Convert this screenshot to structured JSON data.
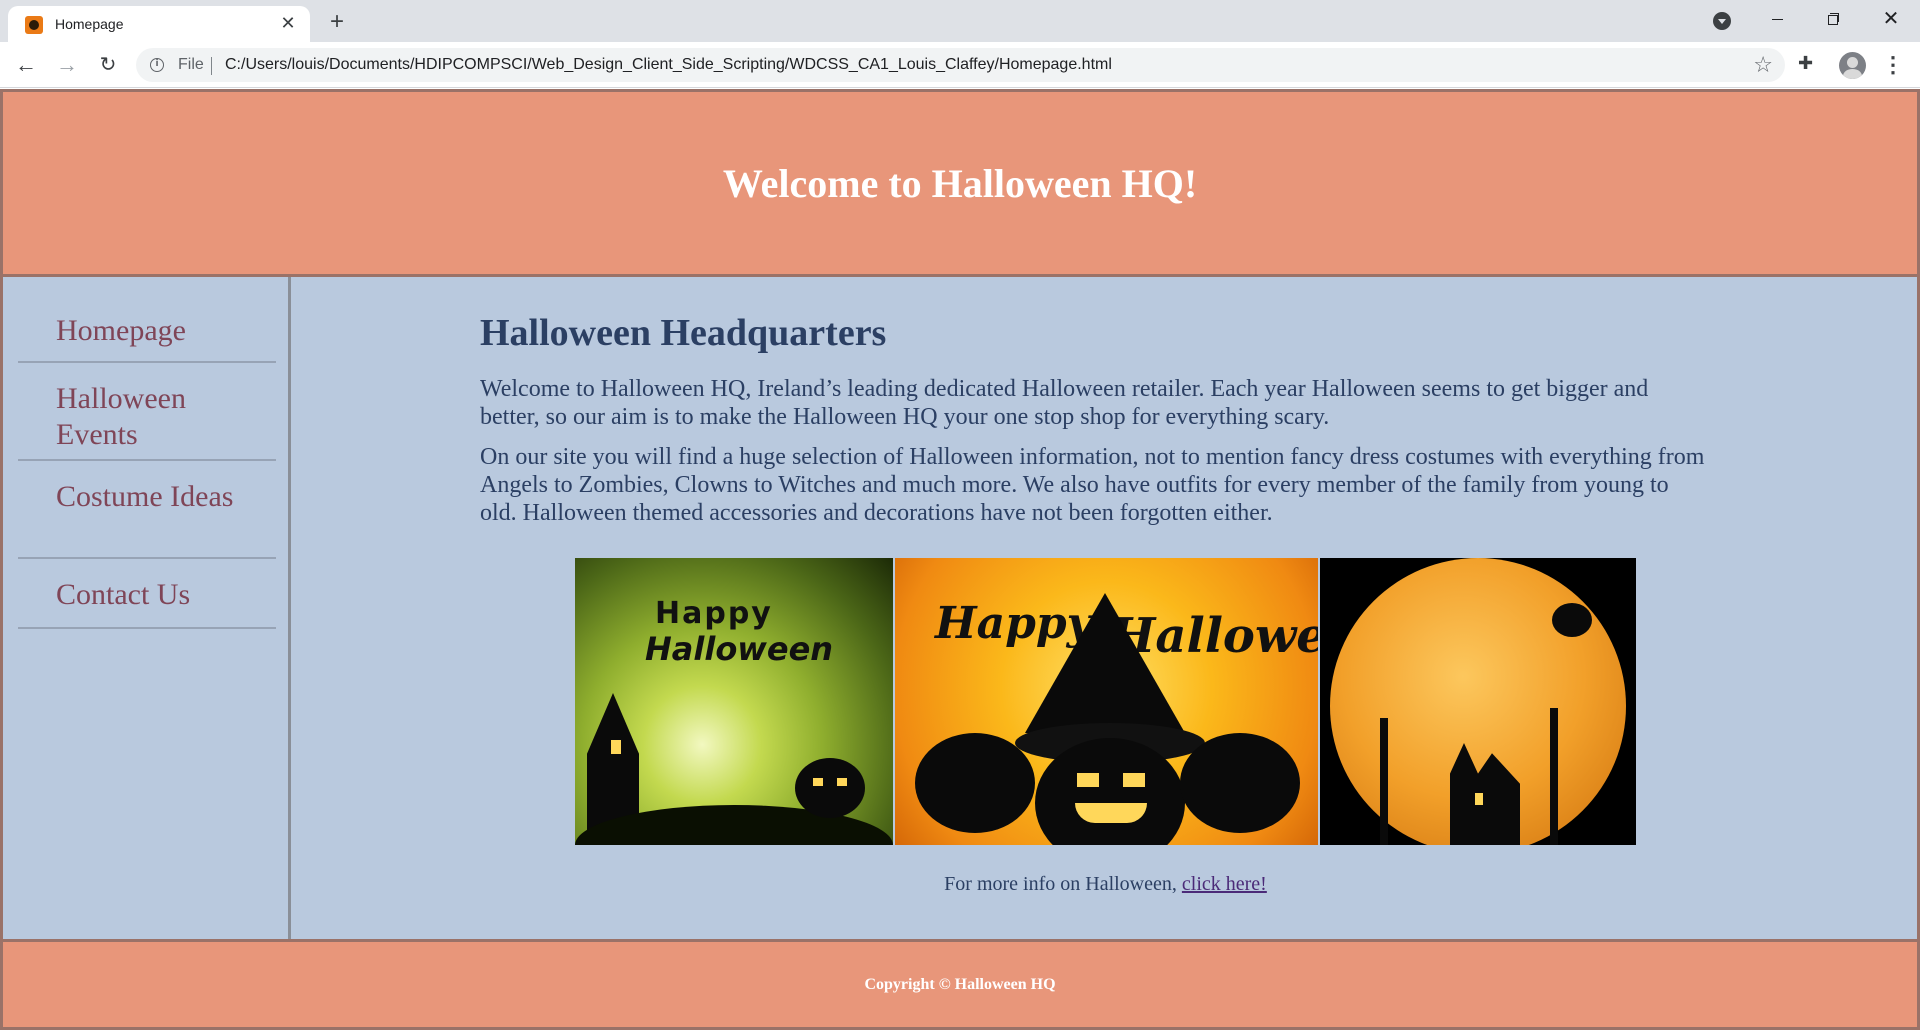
{
  "browser": {
    "tab_title": "Homepage",
    "tab_close": "✕",
    "new_tab": "+",
    "url_scheme": "File",
    "url": "C:/Users/louis/Documents/HDIPCOMPSCI/Web_Design_Client_Side_Scripting/WDCSS_CA1_Louis_Claffey/Homepage.html"
  },
  "header": {
    "title": "Welcome to Halloween HQ!"
  },
  "sidebar": {
    "items": [
      {
        "label": "Homepage"
      },
      {
        "label": "Halloween Events"
      },
      {
        "label": "Costume Ideas"
      },
      {
        "label": "Contact Us"
      }
    ]
  },
  "main": {
    "title": "Halloween Headquarters",
    "paragraphs": [
      "Welcome to Halloween HQ, Ireland’s leading dedicated Halloween retailer. Each year Halloween seems to get bigger and better, so our aim is to make the Halloween HQ your one stop shop for everything scary.",
      "On our site you will find a huge selection of Halloween information, not to mention fancy dress costumes with everything from Angels to Zombies, Clowns to Witches and much more. We also have outfits for every member of the family from young to old. Halloween themed accessories and decorations have not been forgotten either."
    ],
    "images": [
      {
        "text_top": "Happy",
        "text_bottom": "Halloween"
      },
      {
        "text_left": "Happy",
        "text_right": "Halloween"
      },
      {}
    ],
    "more_info_text": "For more info on Halloween, ",
    "more_info_link": "click here!"
  },
  "footer": {
    "copyright": "Copyright © Halloween HQ"
  },
  "colors": {
    "header_bg": "#e8967a",
    "page_bg": "#b9c9de",
    "nav_text": "#7f4557",
    "body_text": "#2b3f63"
  }
}
